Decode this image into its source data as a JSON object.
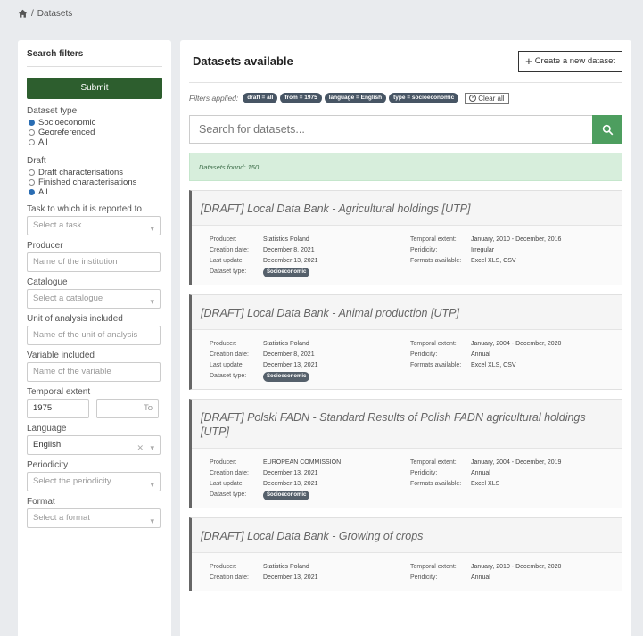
{
  "breadcrumb": {
    "current": "Datasets"
  },
  "sidebar": {
    "title": "Search filters",
    "submit_label": "Submit",
    "dataset_type": {
      "label": "Dataset type",
      "options": [
        "Socioeconomic",
        "Georeferenced",
        "All"
      ],
      "selected": "Socioeconomic"
    },
    "draft": {
      "label": "Draft",
      "options": [
        "Draft characterisations",
        "Finished characterisations",
        "All"
      ],
      "selected": "All"
    },
    "task": {
      "label": "Task to which it is reported to",
      "placeholder": "Select a task"
    },
    "producer": {
      "label": "Producer",
      "placeholder": "Name of the institution"
    },
    "catalogue": {
      "label": "Catalogue",
      "placeholder": "Select a catalogue"
    },
    "unit": {
      "label": "Unit of analysis included",
      "placeholder": "Name of the unit of analysis"
    },
    "variable": {
      "label": "Variable included",
      "placeholder": "Name of the variable"
    },
    "temporal": {
      "label": "Temporal extent",
      "from_value": "1975",
      "to_placeholder": "To"
    },
    "language": {
      "label": "Language",
      "value": "English"
    },
    "periodicity": {
      "label": "Periodicity",
      "placeholder": "Select the periodicity"
    },
    "format": {
      "label": "Format",
      "placeholder": "Select a format"
    }
  },
  "main": {
    "title": "Datasets available",
    "create_label": "Create a new dataset",
    "filters_label": "Filters applied:",
    "chips": [
      "draft = all",
      "from = 1975",
      "language = English",
      "type = socioeconomic"
    ],
    "clear_label": "Clear all",
    "search_placeholder": "Search for datasets...",
    "found_text": "Datasets found: 150",
    "field_labels": {
      "producer": "Producer:",
      "creation": "Creation date:",
      "update": "Last update:",
      "type": "Dataset type:",
      "temporal": "Temporal extent:",
      "periodicity": "Peridicity:",
      "formats": "Formats available:"
    },
    "cards": [
      {
        "title": "[DRAFT] Local Data Bank - Agricultural holdings [UTP]",
        "producer": "Statistics Poland",
        "creation": "December 8, 2021",
        "update": "December 13, 2021",
        "type": "Socioeconomic",
        "temporal": "January, 2010 - December, 2016",
        "periodicity": "Irregular",
        "formats": "Excel XLS, CSV"
      },
      {
        "title": "[DRAFT] Local Data Bank - Animal production [UTP]",
        "producer": "Statistics Poland",
        "creation": "December 8, 2021",
        "update": "December 13, 2021",
        "type": "Socioeconomic",
        "temporal": "January, 2004 - December, 2020",
        "periodicity": "Annual",
        "formats": "Excel XLS, CSV"
      },
      {
        "title": "[DRAFT] Polski FADN - Standard Results of Polish FADN agricultural holdings [UTP]",
        "producer": "EUROPEAN COMMISSION",
        "creation": "December 13, 2021",
        "update": "December 13, 2021",
        "type": "Socioeconomic",
        "temporal": "January, 2004 - December, 2019",
        "periodicity": "Annual",
        "formats": "Excel XLS"
      },
      {
        "title": "[DRAFT] Local Data Bank - Growing of crops",
        "producer": "Statistics Poland",
        "creation": "December 13, 2021",
        "temporal": "January, 2010 - December, 2020",
        "periodicity": "Annual"
      }
    ]
  }
}
